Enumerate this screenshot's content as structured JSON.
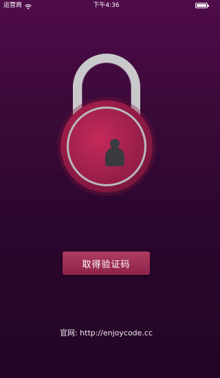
{
  "status_bar": {
    "carrier": "运营商",
    "time": "下午4:36",
    "wifi_icon": "wifi-icon",
    "battery_icon": "battery-icon"
  },
  "lock": {
    "icon": "padlock-icon"
  },
  "actions": {
    "get_code_label": "取得验证码"
  },
  "footer": {
    "website": "官网: http://enjoycode.cc"
  },
  "colors": {
    "background_top": "#4f0b4a",
    "background_bottom": "#230526",
    "lock_body": "#9c1f4b",
    "shackle": "#c9c9cc",
    "button": "#a03058"
  }
}
